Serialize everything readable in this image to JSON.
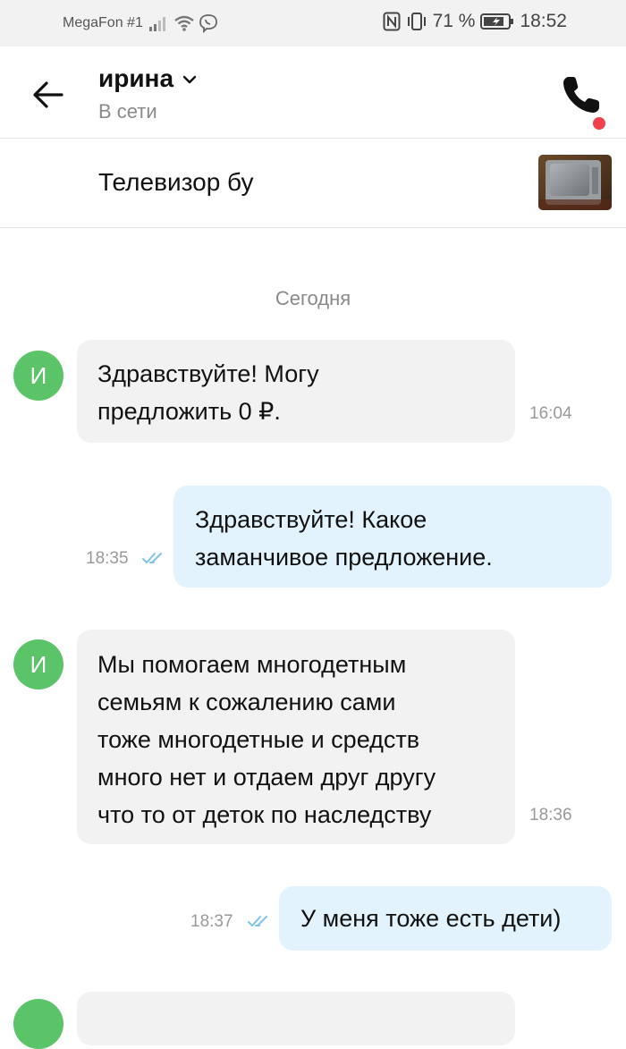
{
  "status_bar": {
    "carrier": "MegaFon #1",
    "battery": "71 %",
    "time": "18:52"
  },
  "header": {
    "contact_name": "ирина",
    "contact_status": "В сети"
  },
  "listing": {
    "title": "Телевизор бу"
  },
  "chat": {
    "date_separator": "Сегодня",
    "messages": [
      {
        "direction": "in",
        "avatar_letter": "И",
        "lines": [
          "Здравствуйте! Могу",
          "предложить 0 ₽."
        ],
        "time": "16:04"
      },
      {
        "direction": "out",
        "lines": [
          "Здравствуйте! Какое",
          "заманчивое предложение."
        ],
        "time": "18:35",
        "status": "read"
      },
      {
        "direction": "in",
        "avatar_letter": "И",
        "lines": [
          "Мы помогаем многодетным",
          "семьям к сожалению сами",
          "тоже многодетные и средств",
          "много нет и отдаем друг другу",
          "что то от деток по наследству"
        ],
        "time": "18:36"
      },
      {
        "direction": "out",
        "lines": [
          "У меня тоже есть дети)"
        ],
        "time": "18:37",
        "status": "read"
      }
    ]
  },
  "colors": {
    "avatar_green": "#5cc468",
    "incoming_bubble": "#f2f2f2",
    "outgoing_bubble": "#e2f3fd",
    "read_ticks": "#7fc4ec",
    "notification_dot": "#f2414b"
  }
}
